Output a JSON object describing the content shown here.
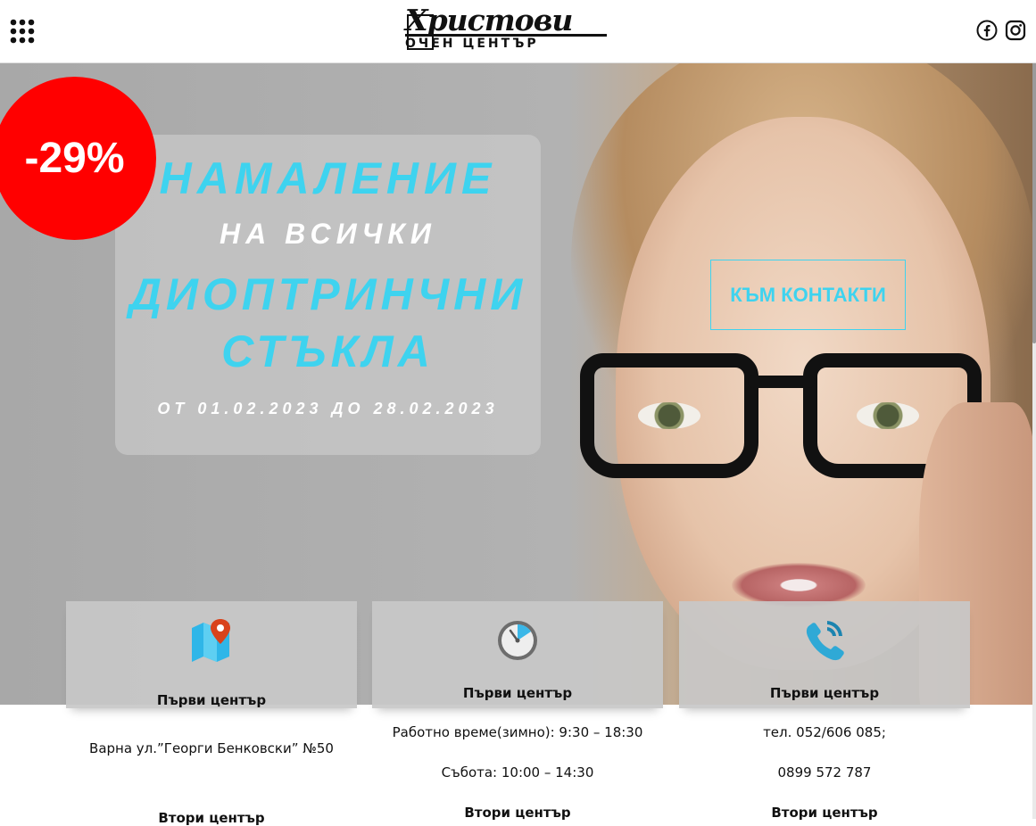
{
  "header": {
    "logo_top": "Христови",
    "logo_bottom": "ОЧЕН ЦЕНТЪР",
    "menu_icon": "grid-dots-icon",
    "social": [
      "facebook-icon",
      "instagram-icon"
    ]
  },
  "hero": {
    "discount": "-29%",
    "promo_line1": "НАМАЛЕНИЕ",
    "promo_line2": "НА ВСИЧКИ",
    "promo_line3": "ДИОПТРИНЧНИ",
    "promo_line4": "СТЪКЛА",
    "promo_dates": "ОТ 01.02.2023 ДО 28.02.2023",
    "cta_label": "КЪМ КОНТАКТИ"
  },
  "cards": [
    {
      "icon": "map-pin-icon",
      "title": "Първи център",
      "lines": [
        "Варна ул.”Георги Бенковски” №50"
      ],
      "second_title": "Втори център"
    },
    {
      "icon": "clock-icon",
      "title": "Първи център",
      "lines": [
        "Работно време(зимно): 9:30 – 18:30",
        "Събота: 10:00 – 14:30"
      ],
      "second_title": "Втори център"
    },
    {
      "icon": "phone-icon",
      "title": "Първи център",
      "lines": [
        "тел. 052/606 085;",
        "0899 572 787"
      ],
      "second_title": "Втори център"
    }
  ],
  "colors": {
    "accent": "#3ed3ef",
    "discount": "#ff0000"
  }
}
